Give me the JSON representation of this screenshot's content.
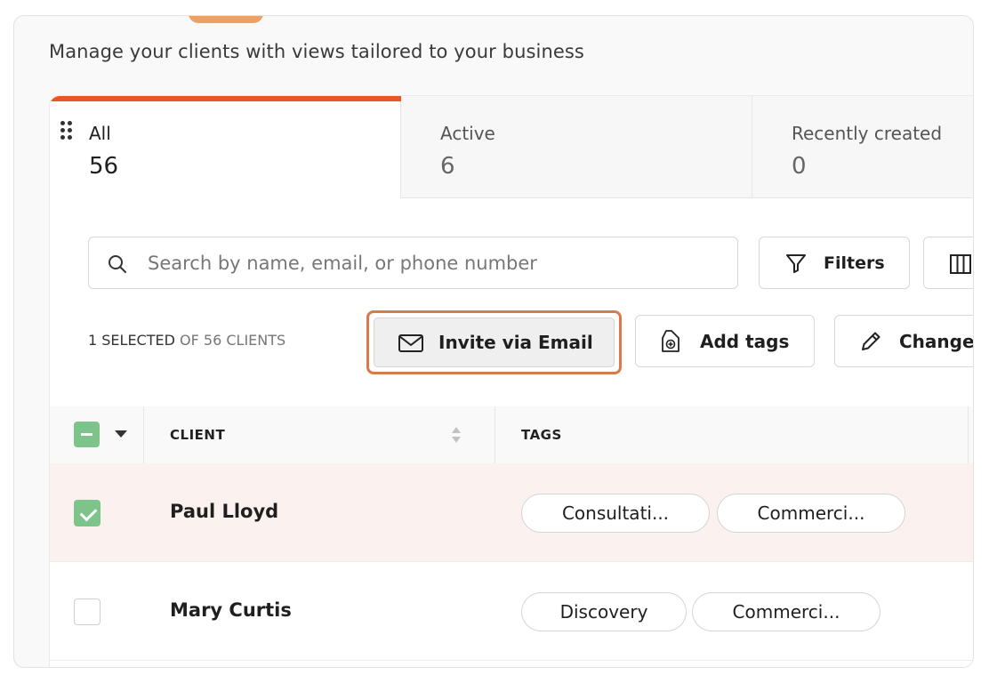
{
  "header": {
    "subtitle": "Manage your clients with views tailored to your business"
  },
  "tabs": [
    {
      "label": "All",
      "count": "56"
    },
    {
      "label": "Active",
      "count": "6"
    },
    {
      "label": "Recently created",
      "count": "0"
    }
  ],
  "search": {
    "placeholder": "Search by name, email, or phone number"
  },
  "toolbar": {
    "filters_label": "Filters",
    "selected_count_strong": "1 SELECTED",
    "selected_count_rest": " OF 56 CLIENTS",
    "invite_label": "Invite via Email",
    "add_tags_label": "Add tags",
    "change_label": "Change"
  },
  "table": {
    "columns": [
      "CLIENT",
      "TAGS"
    ],
    "rows": [
      {
        "name": "Paul Lloyd",
        "selected": true,
        "tags": [
          "Consultati...",
          "Commerci..."
        ]
      },
      {
        "name": "Mary Curtis",
        "selected": false,
        "tags": [
          "Discovery",
          "Commerci..."
        ]
      }
    ]
  },
  "colors": {
    "accent": "#e8562a",
    "highlight_outline": "#d77a4e",
    "checkbox_green": "#7cc489",
    "selected_row_bg": "#fbf1ee"
  }
}
